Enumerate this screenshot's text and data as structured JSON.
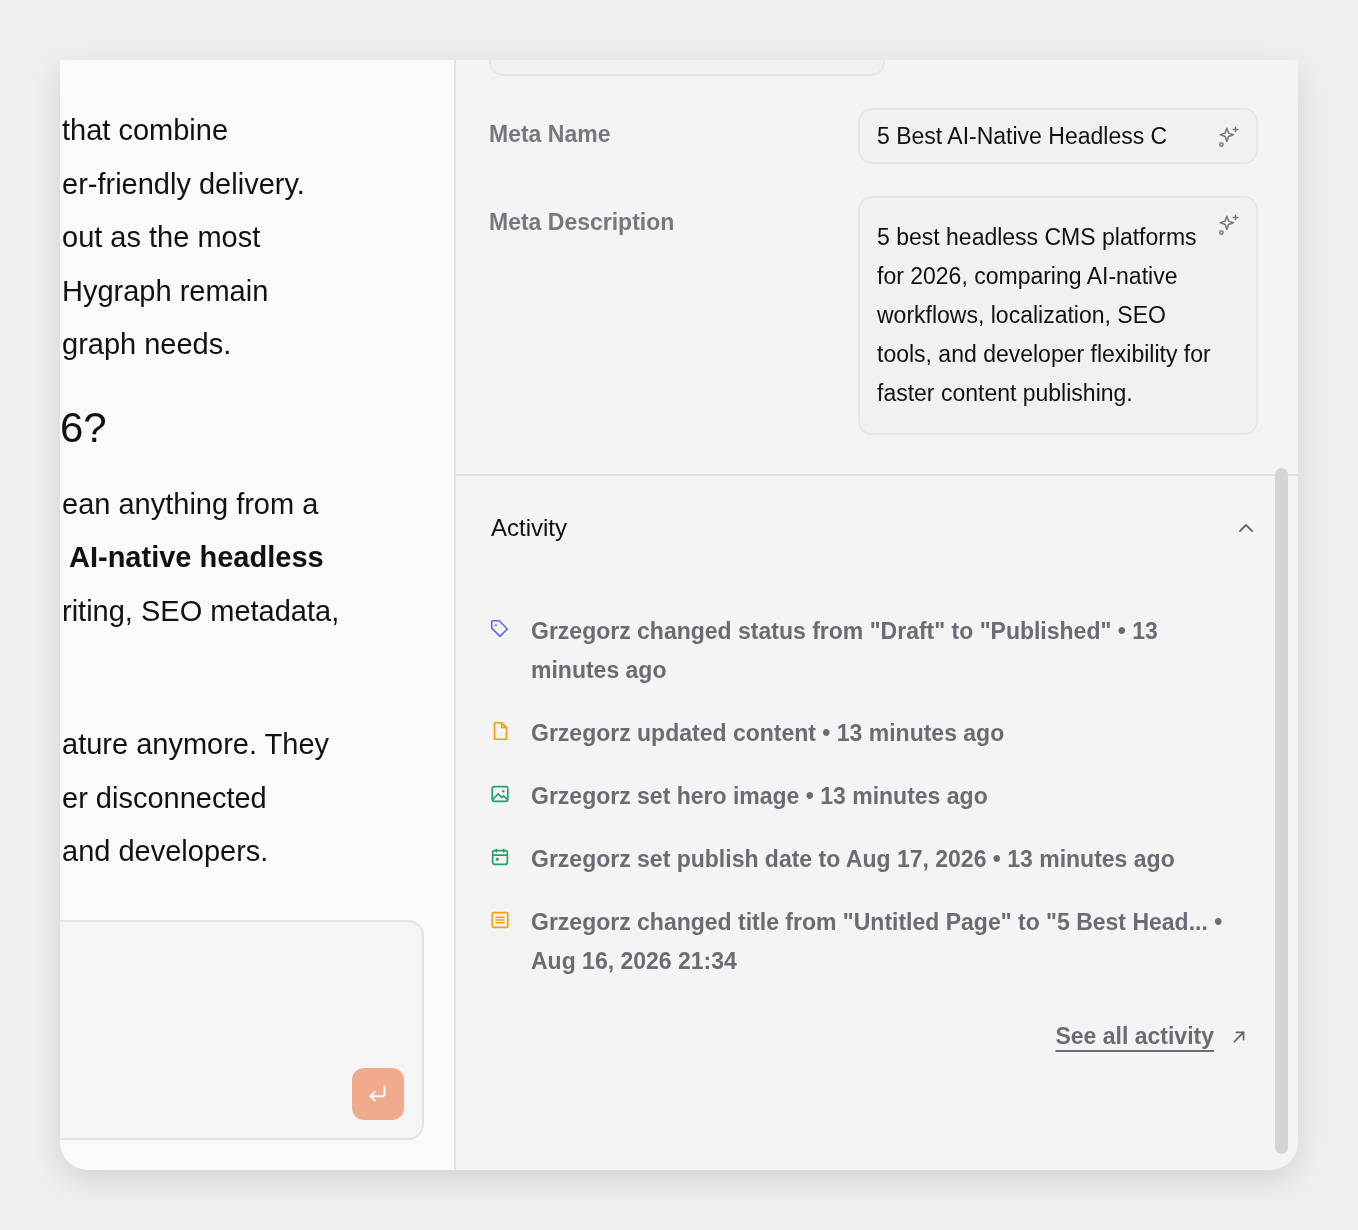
{
  "article": {
    "lines": [
      {
        "kind": "text",
        "text": "that combine"
      },
      {
        "kind": "text",
        "text": "er-friendly delivery."
      },
      {
        "kind": "text",
        "text": "out as the most"
      },
      {
        "kind": "text",
        "text": "Hygraph remain"
      },
      {
        "kind": "text",
        "text": "graph needs."
      },
      {
        "kind": "heading",
        "text": "6?"
      },
      {
        "kind": "text",
        "text": "ean anything from a"
      },
      {
        "kind": "bold",
        "text": "AI-native headless"
      },
      {
        "kind": "text",
        "text": "riting, SEO metadata,"
      },
      {
        "kind": "blank"
      },
      {
        "kind": "text",
        "text": "ature anymore. They"
      },
      {
        "kind": "text",
        "text": "er disconnected"
      },
      {
        "kind": "text",
        "text": "and developers."
      }
    ]
  },
  "seo": {
    "fields": [
      {
        "label": "Meta Name",
        "value": "5 Best AI-Native Headless C",
        "multiline": false
      },
      {
        "label": "Meta Description",
        "value": "5 best headless CMS platforms for 2026, comparing AI-native workflows, localization, SEO tools, and developer flexibility for faster content publishing.",
        "multiline": true
      }
    ]
  },
  "activity": {
    "title": "Activity",
    "expanded": true,
    "items": [
      {
        "kind": "tag",
        "color": "#6366f1",
        "text": "Grzegorz changed status from \"Draft\" to \"Published\" • 13 minutes ago"
      },
      {
        "kind": "file",
        "color": "#f59e0b",
        "text": "Grzegorz updated content • 13 minutes ago"
      },
      {
        "kind": "image",
        "color": "#22a06b",
        "text": "Grzegorz set hero image • 13 minutes ago"
      },
      {
        "kind": "calendar",
        "color": "#22a06b",
        "text": "Grzegorz set publish date to Aug 17, 2026 • 13 minutes ago"
      },
      {
        "kind": "list",
        "color": "#f59e0b",
        "text": "Grzegorz changed title from \"Untitled Page\" to \"5 Best Head... • Aug 16, 2026 21:34"
      }
    ],
    "link": "See all activity"
  }
}
